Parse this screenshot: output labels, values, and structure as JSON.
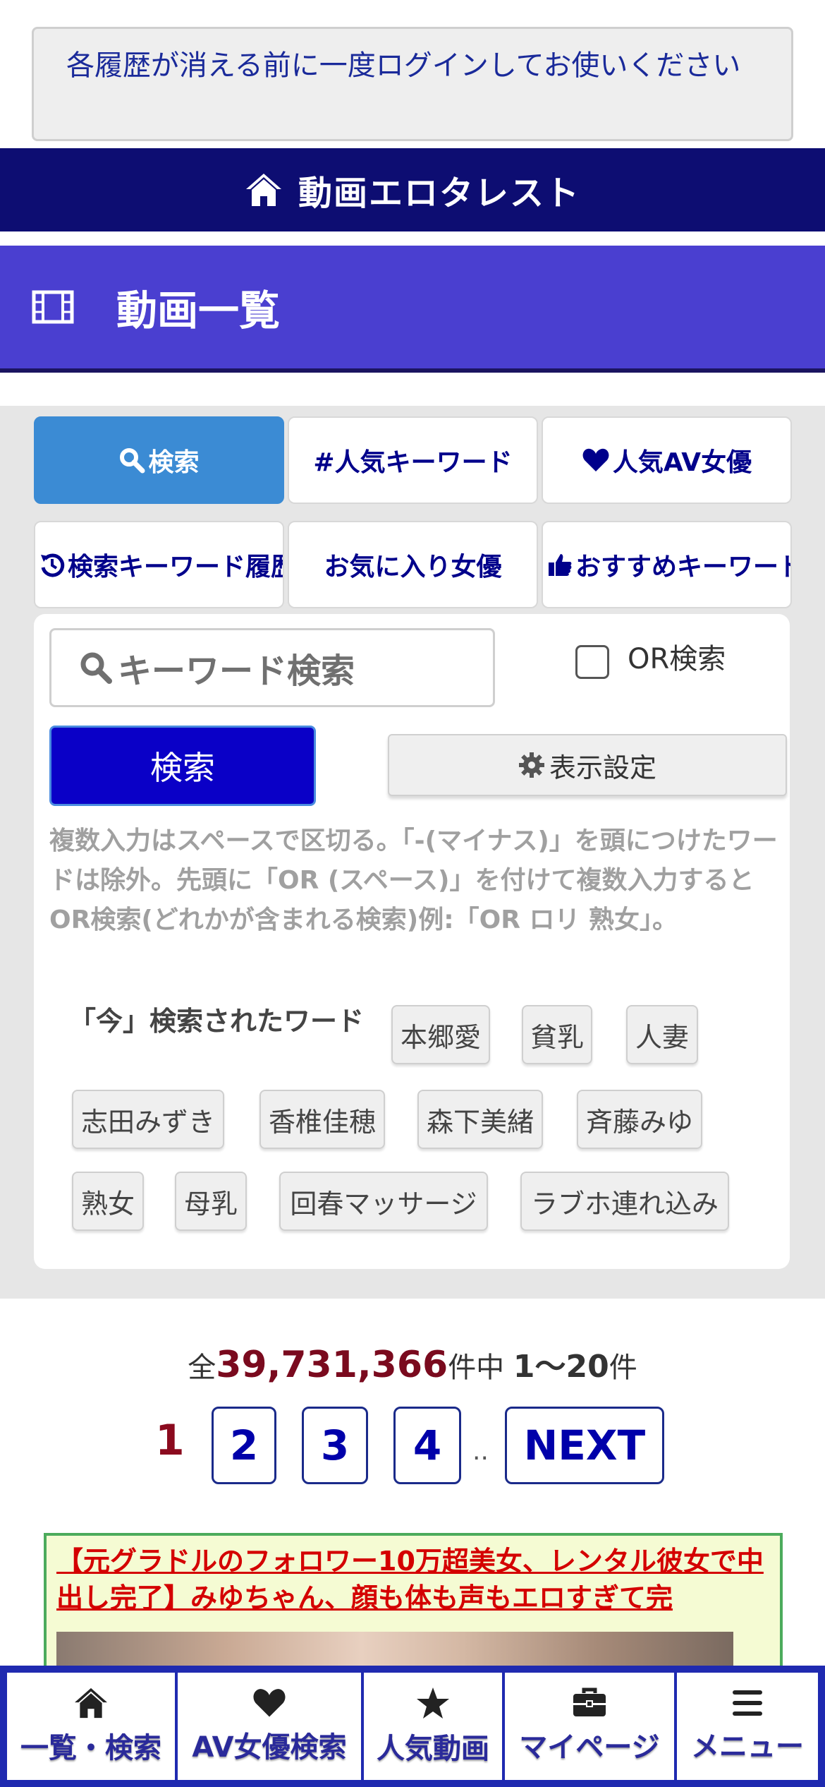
{
  "notice": {
    "text": "各履歴が消える前に一度ログインしてお使いください"
  },
  "header": {
    "site_title": "動画エロタレスト"
  },
  "page": {
    "title": "動画一覧"
  },
  "tabs": [
    {
      "label": "検索",
      "icon": "search-icon"
    },
    {
      "label": "#人気キーワード"
    },
    {
      "label": "人気AV女優",
      "icon": "heart-icon"
    },
    {
      "label": "検索キーワード履歴",
      "icon": "history-icon"
    },
    {
      "label": "お気に入り女優"
    },
    {
      "label": "おすすめキーワード",
      "icon": "thumbs-up-icon"
    }
  ],
  "search": {
    "placeholder": "キーワード検索",
    "or_label": "OR検索",
    "submit_label": "検索",
    "display_settings_label": "表示設定",
    "help_text": "複数入力はスペースで区切る。「-(マイナス)」を頭につけたワードは除外。先頭に「OR (スペース)」を付けて複数入力するとOR検索(どれかが含まれる検索)例:「OR ロリ 熟女」。"
  },
  "trending": {
    "label": "「今」検索されたワード",
    "words": [
      "本郷愛",
      "貧乳",
      "人妻",
      "志田みずき",
      "香椎佳穂",
      "森下美緒",
      "斉藤みゆ",
      "熟女",
      "母乳",
      "回春マッサージ",
      "ラブホ連れ込み"
    ]
  },
  "results": {
    "prefix": "全",
    "total": "39,731,366",
    "middle": "件中 ",
    "range": "1〜20",
    "suffix": "件"
  },
  "pagination": {
    "current": "1",
    "pages": [
      "2",
      "3",
      "4"
    ],
    "dots": "..",
    "next": "NEXT"
  },
  "promo": {
    "text": "【元グラドルのフォロワー10万超美女、レンタル彼女で中出し完了】みゆちゃん、顔も体も声もエロすぎて完"
  },
  "bottom_nav": [
    {
      "label": "一覧・検索",
      "icon": "home-icon"
    },
    {
      "label": "AV女優検索",
      "icon": "heart-icon"
    },
    {
      "label": "人気動画",
      "icon": "star-icon"
    },
    {
      "label": "マイページ",
      "icon": "briefcase-icon"
    },
    {
      "label": "メニュー",
      "icon": "menu-icon"
    }
  ],
  "colors": {
    "header_bg": "#0d0d72",
    "title_bg": "#4a3fd0",
    "active_tab": "#3b8bd4",
    "search_button": "#0a00c7",
    "total_count": "#7a0a1e",
    "nav_bg": "#1f2ab0"
  }
}
